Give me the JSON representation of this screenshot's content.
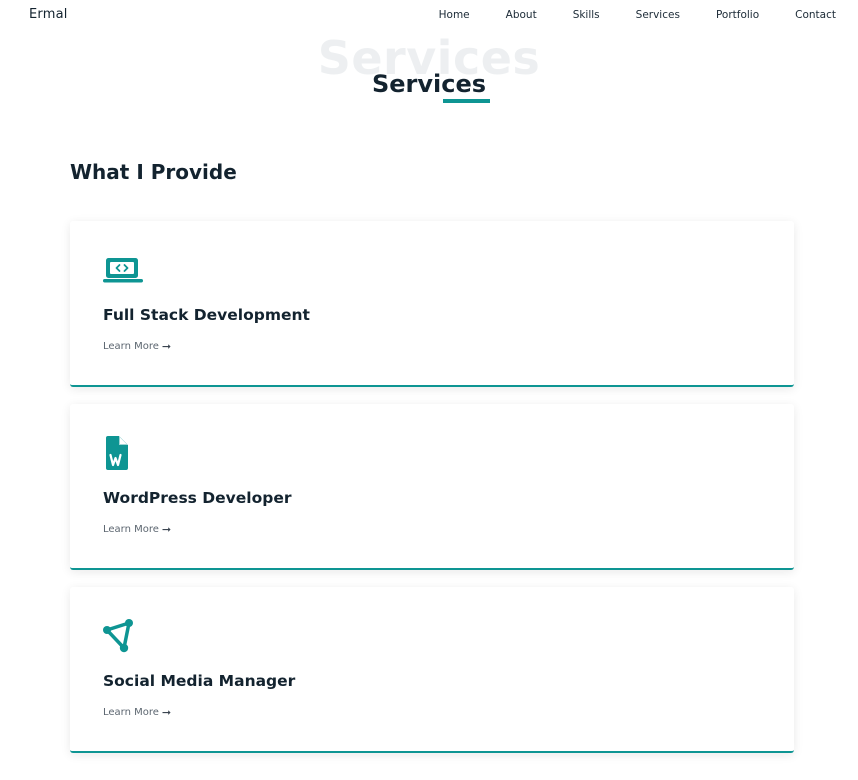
{
  "brand": "Ermal",
  "nav": {
    "items": [
      "Home",
      "About",
      "Skills",
      "Services",
      "Portfolio",
      "Contact"
    ]
  },
  "section": {
    "bg_title": "Services",
    "title": "Services",
    "subheading": "What I Provide"
  },
  "services": [
    {
      "icon": "laptop-code-icon",
      "title": "Full Stack Development",
      "link": "Learn More",
      "arrow": "➞"
    },
    {
      "icon": "word-file-icon",
      "title": "WordPress Developer",
      "link": "Learn More",
      "arrow": "➞"
    },
    {
      "icon": "share-network-icon",
      "title": "Social Media Manager",
      "link": "Learn More",
      "arrow": "➞"
    }
  ],
  "colors": {
    "accent": "#0e9593",
    "text": "#13232f",
    "muted": "#5c6670",
    "ghost": "#eaedef"
  }
}
